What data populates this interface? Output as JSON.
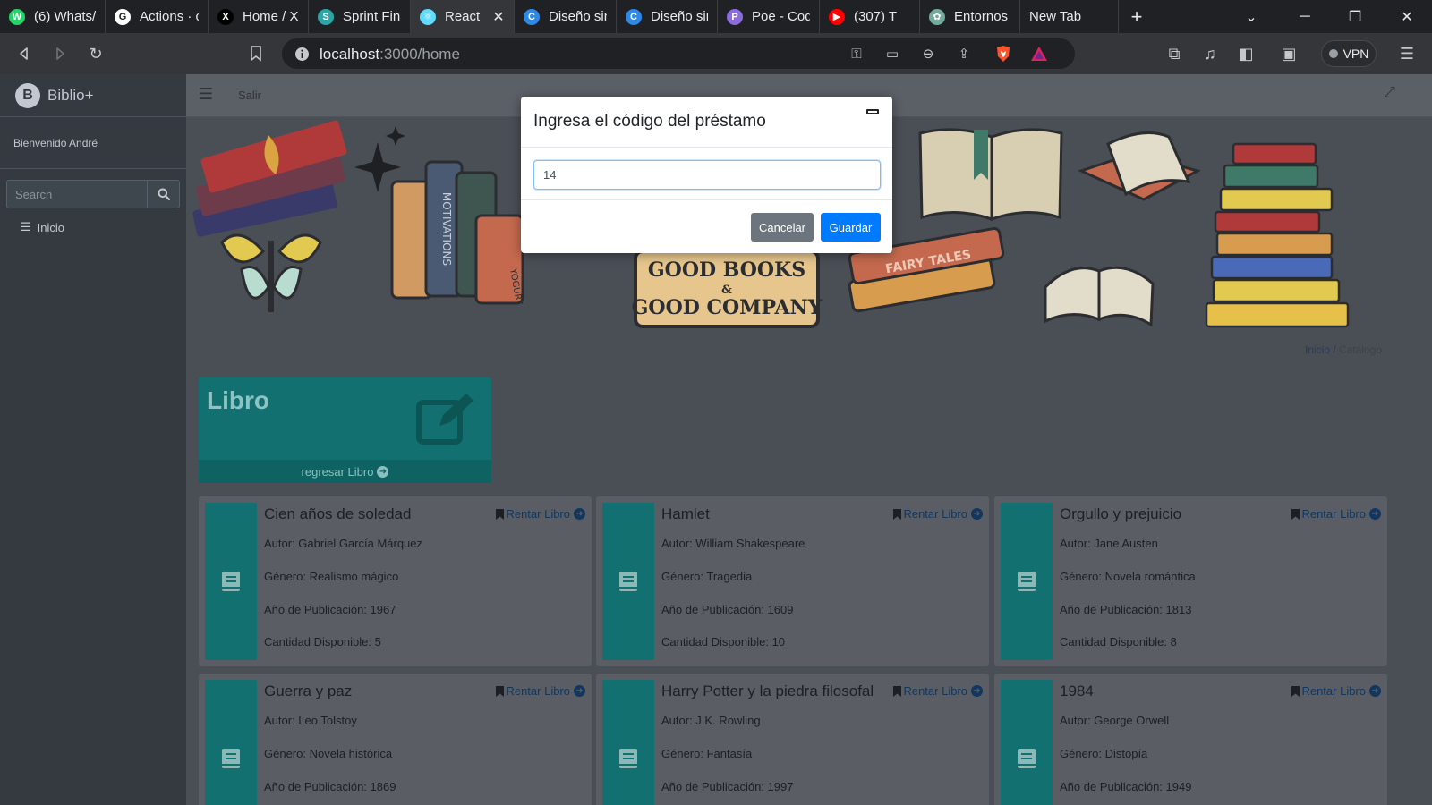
{
  "browser": {
    "tabs": [
      {
        "title": "(6) Whats/",
        "color": "#25d366",
        "glyph": "W"
      },
      {
        "title": "Actions · c",
        "color": "#ffffff",
        "glyph": "G"
      },
      {
        "title": "Home / X",
        "color": "#000000",
        "glyph": "X"
      },
      {
        "title": "Sprint Fina",
        "color": "#2aa6a6",
        "glyph": "S"
      },
      {
        "title": "React",
        "color": "#61dafb",
        "glyph": "⚛"
      },
      {
        "title": "Diseño sin",
        "color": "#2d88e6",
        "glyph": "C"
      },
      {
        "title": "Diseño sin",
        "color": "#2d88e6",
        "glyph": "C"
      },
      {
        "title": "Poe - Cod",
        "color": "#8c6bdc",
        "glyph": "P"
      },
      {
        "title": "(307) T",
        "color": "#ff0000",
        "glyph": "▶"
      },
      {
        "title": "Entornos",
        "color": "#74aa9c",
        "glyph": "✿"
      },
      {
        "title": "New Tab",
        "color": "",
        "glyph": ""
      }
    ],
    "url_host": "localhost",
    "url_path": ":3000/home",
    "vpn_label": "VPN"
  },
  "sidebar": {
    "brand_logo": "B",
    "brand": "Biblio+",
    "welcome": "Bienvenido André",
    "search_placeholder": "Search",
    "nav_home": "Inicio"
  },
  "topnav": {
    "exit": "Salir"
  },
  "breadcrumb": {
    "home": "Inicio",
    "current": "Catálogo"
  },
  "summary_box": {
    "title": "Libro",
    "footer": "regresar Libro"
  },
  "labels": {
    "rent": "Rentar Libro",
    "author": "Autor: ",
    "genre": "Género: ",
    "year": "Año de Publicación: ",
    "qty": "Cantidad Disponible: "
  },
  "books": [
    {
      "title": "Cien años de soledad",
      "author": "Gabriel García Márquez",
      "genre": "Realismo mágico",
      "year": "1967",
      "qty": "5"
    },
    {
      "title": "Hamlet",
      "author": "William Shakespeare",
      "genre": "Tragedia",
      "year": "1609",
      "qty": "10"
    },
    {
      "title": "Orgullo y prejuicio",
      "author": "Jane Austen",
      "genre": "Novela romántica",
      "year": "1813",
      "qty": "8"
    },
    {
      "title": "Guerra y paz",
      "author": "Leo Tolstoy",
      "genre": "Novela histórica",
      "year": "1869",
      "qty": ""
    },
    {
      "title": "Harry Potter y la piedra filosofal",
      "author": "J.K. Rowling",
      "genre": "Fantasía",
      "year": "1997",
      "qty": ""
    },
    {
      "title": "1984",
      "author": "George Orwell",
      "genre": "Distopía",
      "year": "1949",
      "qty": ""
    }
  ],
  "hero_art": {
    "badge_line1": "GOOD BOOKS",
    "badge_amp": "&",
    "badge_line2": "GOOD COMPANY",
    "spine_1": "MOTIVATIONS",
    "spine_2": "FAIRY TALES",
    "spine_3": "YOGURT"
  },
  "modal": {
    "title": "Ingresa el código del préstamo",
    "input_value": "14",
    "cancel": "Cancelar",
    "save": "Guardar"
  },
  "colors": {
    "teal": "#127070",
    "primary": "#007bff",
    "secondary": "#6c757d",
    "sidebar": "#343a40"
  }
}
